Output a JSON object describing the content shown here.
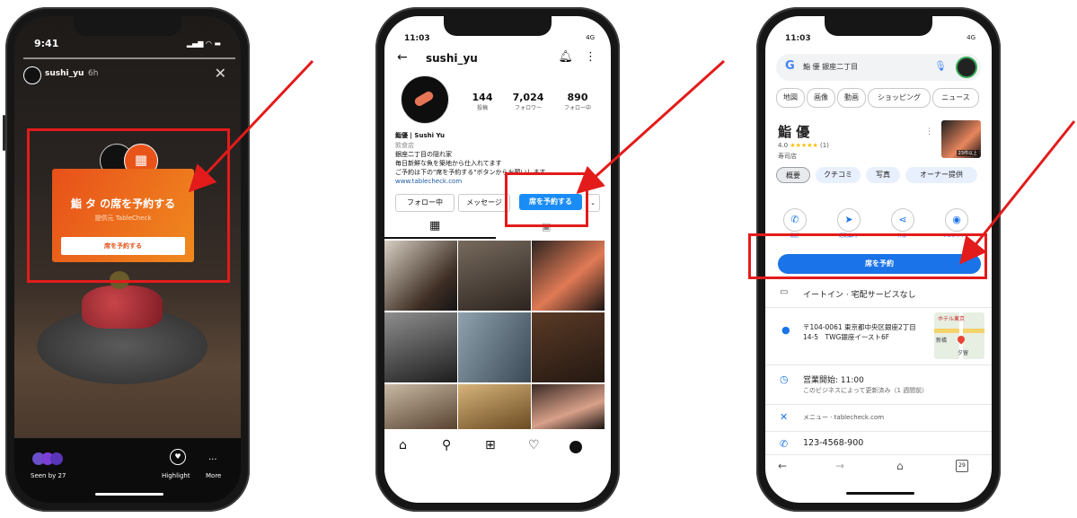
{
  "story": {
    "time": "9:41",
    "username": "sushi_yu",
    "age": "6h",
    "title": "鮨 タ の席を予約する",
    "provider": "提供元 TableCheck",
    "reserve_btn": "席を予約する",
    "seen_by": "Seen by 27",
    "highlight": "Highlight",
    "more": "More"
  },
  "profile": {
    "time": "11:03",
    "network": "4G",
    "username": "sushi_yu",
    "stats": [
      {
        "value": "144",
        "label": "投稿"
      },
      {
        "value": "7,024",
        "label": "フォロワー"
      },
      {
        "value": "890",
        "label": "フォロー中"
      }
    ],
    "name": "鮨優 | Sushi Yu",
    "category": "飲食店",
    "bio1": "銀座二丁目の隠れ家",
    "bio2": "毎日新鮮な魚を築地から仕入れてます",
    "bio3": "ご予約は下の\"席を予約する\"ボタンからお願いします",
    "link": "www.tablecheck.com",
    "btn_follow": "フォロー中",
    "btn_message": "メッセージ",
    "btn_reserve": "席を予約する"
  },
  "maps": {
    "time": "11:03",
    "network": "4G",
    "query": "鮨 優 銀座二丁目",
    "filters": [
      "地図",
      "画像",
      "動画",
      "ショッピング",
      "ニュース"
    ],
    "place_name": "鮨 優",
    "rating": "4.0",
    "stars": "★★★★★",
    "review_count": "(1)",
    "type": "寿司店",
    "photo_count": "23件以上",
    "tabs": [
      "概要",
      "クチコミ",
      "写真",
      "オーナー提供"
    ],
    "actions": [
      "電話",
      "経路案内",
      "共有",
      "ウェブサイト"
    ],
    "reserve_btn": "席を予約",
    "service": "イートイン · 宅配サービスなし",
    "address1": "〒104-0061 東京都中央区銀座2丁目",
    "address2": "14-5　TWG銀座イースト6F",
    "map_label": "ホテル東京",
    "map_label2": "新橋",
    "map_label3": "夕留",
    "hours": "営業開始: 11:00",
    "hours_note": "このビジネスによって更新済み（1 週間前）",
    "menu": "メニュー · tablecheck.com",
    "phone": "123-4568-900",
    "tabs_count": "29"
  },
  "colors": {
    "highlight_red": "#e31b1b",
    "tablecheck_orange": "#ee6a1c",
    "ig_blue": "#1a8cf5",
    "maps_blue": "#1a73e8"
  }
}
